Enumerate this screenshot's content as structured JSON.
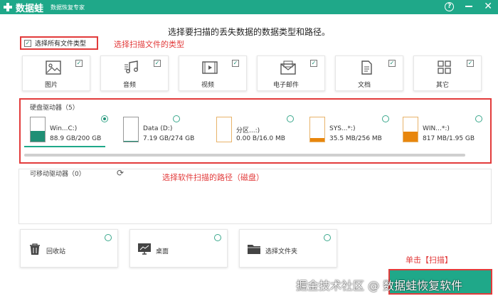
{
  "app": {
    "name": "数据蛙",
    "subtitle": "数据恢复专家"
  },
  "headline": "选择要扫描的丢失数据的数据类型和路径。",
  "select_all": {
    "label": "选择所有文件类型",
    "checked": true
  },
  "annotations": {
    "file_types": "选择扫描文件的类型",
    "path": "选择软件扫描的路径（磁盘）",
    "scan": "单击【扫描】"
  },
  "file_types": [
    {
      "label": "图片",
      "icon": "image-icon",
      "checked": true
    },
    {
      "label": "音频",
      "icon": "music-icon",
      "checked": true
    },
    {
      "label": "视频",
      "icon": "video-icon",
      "checked": true
    },
    {
      "label": "电子邮件",
      "icon": "email-icon",
      "checked": true
    },
    {
      "label": "文档",
      "icon": "document-icon",
      "checked": true
    },
    {
      "label": "其它",
      "icon": "other-icon",
      "checked": true
    }
  ],
  "hard_drives": {
    "title": "硬盘驱动器（5）",
    "drives": [
      {
        "name": "Win...C:)",
        "size": "88.9 GB/200 GB",
        "usage": 0.44,
        "selected": true
      },
      {
        "name": "Data (D:)",
        "size": "7.19 GB/274 GB",
        "usage": 0.03,
        "selected": false
      },
      {
        "name": "分区...:)",
        "size": "0.00  B/16.0 MB",
        "usage": 0.0,
        "selected": false
      },
      {
        "name": "SYS...*:)",
        "size": "35.5 MB/256 MB",
        "usage": 0.14,
        "selected": false
      },
      {
        "name": "WIN...*:)",
        "size": "817 MB/1.95 GB",
        "usage": 0.42,
        "selected": false
      }
    ]
  },
  "removable": {
    "title": "可移动驱动器（0）"
  },
  "locations": [
    {
      "label": "回收站",
      "icon": "recycle-bin-icon"
    },
    {
      "label": "桌面",
      "icon": "desktop-icon"
    },
    {
      "label": "选择文件夹",
      "icon": "folder-icon"
    }
  ],
  "watermark": "掘金技术社区 @ 数据蛙恢复软件",
  "colors": {
    "accent": "#1fa889",
    "annotation": "#e23b3b",
    "drive_low": "#1f8f75",
    "drive_warn": "#e8860c"
  }
}
